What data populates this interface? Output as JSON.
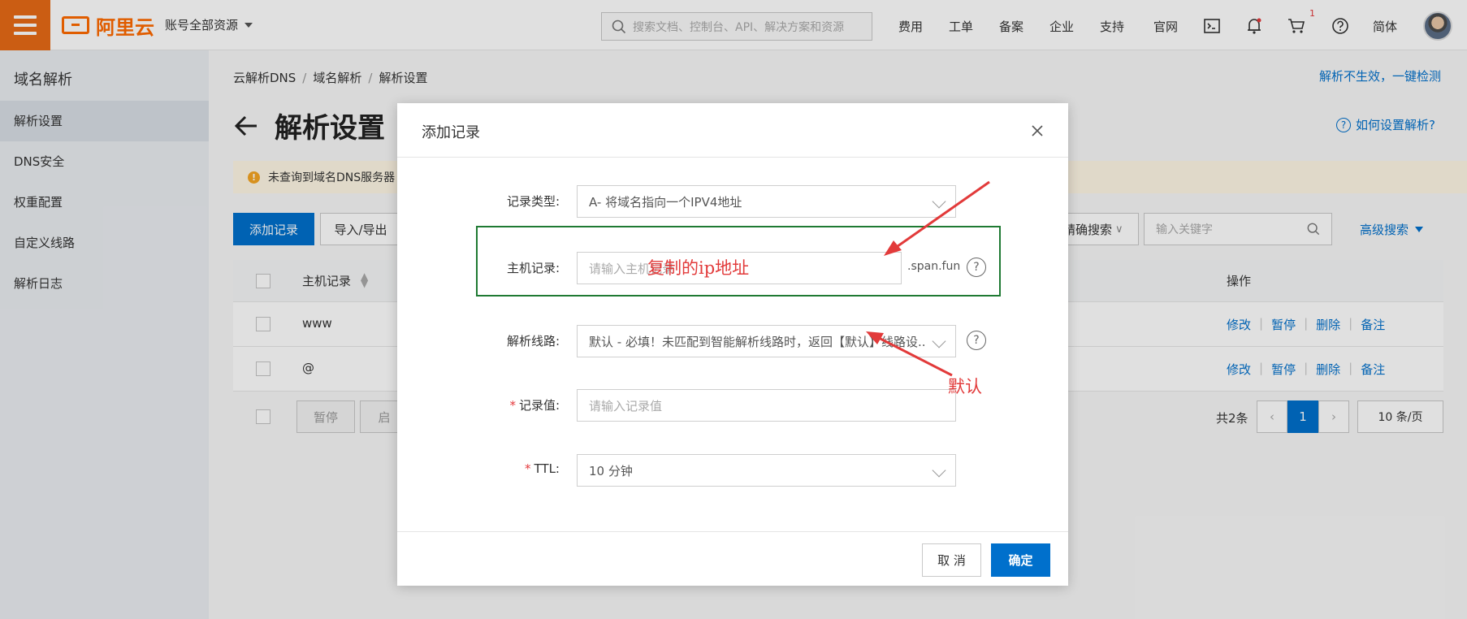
{
  "topbar": {
    "logo_text": "阿里云",
    "account": "账号全部资源",
    "search_placeholder": "搜索文档、控制台、API、解决方案和资源",
    "nav": [
      "费用",
      "工单",
      "备案",
      "企业",
      "支持",
      "官网"
    ],
    "cart_count": "1",
    "lang": "简体"
  },
  "sidebar": {
    "title": "域名解析",
    "items": [
      "解析设置",
      "DNS安全",
      "权重配置",
      "自定义线路",
      "解析日志"
    ]
  },
  "main": {
    "breadcrumb": [
      "云解析DNS",
      "域名解析",
      "解析设置"
    ],
    "check_link": "解析不生效，一键检测",
    "title": "解析设置",
    "help_link": "如何设置解析?",
    "warning": "未查询到域名DNS服务器",
    "add_button": "添加记录",
    "import_button": "导入/导出",
    "exact_search": "精确搜索",
    "keyword_placeholder": "输入关键字",
    "advanced_search": "高级搜索",
    "table": {
      "col_host": "主机记录",
      "col_ops": "操作",
      "rows": [
        {
          "host": "www",
          "ops": [
            "修改",
            "暂停",
            "删除",
            "备注"
          ]
        },
        {
          "host": "@",
          "ops": [
            "修改",
            "暂停",
            "删除",
            "备注"
          ]
        }
      ],
      "pause_button": "暂停",
      "enable_button": "启",
      "total": "共2条",
      "current_page": "1",
      "page_size": "10 条/页"
    }
  },
  "modal": {
    "title": "添加记录",
    "fields": {
      "type_label": "记录类型:",
      "type_value": "A- 将域名指向一个IPV4地址",
      "host_label": "主机记录:",
      "host_placeholder": "请输入主机记录",
      "host_suffix": ".span.fun",
      "line_label": "解析线路:",
      "line_value": "默认 - 必填！未匹配到智能解析线路时，返回【默认】线路设...",
      "value_label": "记录值:",
      "value_placeholder": "请输入记录值",
      "ttl_label": "TTL:",
      "ttl_value": "10 分钟"
    },
    "cancel": "取 消",
    "confirm": "确定"
  },
  "annotations": {
    "host_note": "复制的ip地址",
    "line_note": "默认"
  },
  "colors": {
    "brand": "#ff6a00",
    "primary": "#0070cc",
    "annotation": "#e23a3a",
    "highlight_box": "#1f7a33"
  }
}
